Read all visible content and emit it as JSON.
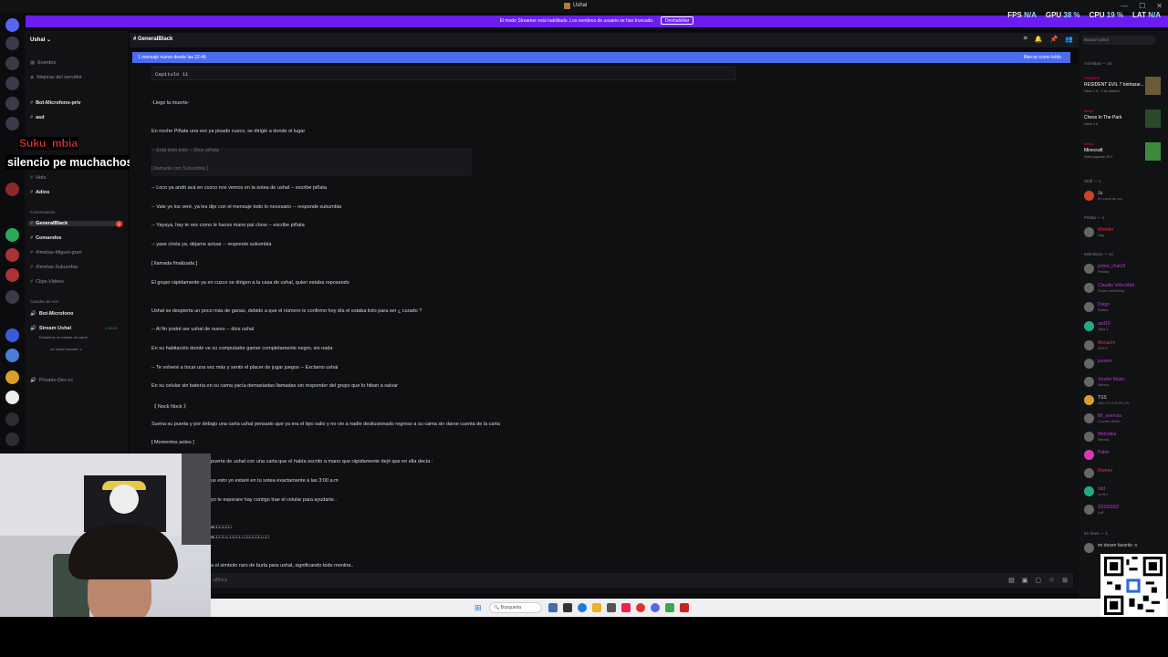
{
  "window": {
    "title": "Ushal"
  },
  "banner": {
    "text": "El modo Streamer está habilitado. Los nombres de usuario se han truncado.",
    "button": "Deshabilitar"
  },
  "overlay_stats": [
    {
      "label": "FPS",
      "value": "N/A"
    },
    {
      "label": "GPU",
      "value": "38 %"
    },
    {
      "label": "CPU",
      "value": "19 %"
    },
    {
      "label": "LAT",
      "value": "N/A"
    }
  ],
  "server": {
    "name": "Ushal ⌄"
  },
  "channels": {
    "events": "Eventos",
    "boosts": "Mejoras del servidor",
    "items": [
      {
        "name": "Bot-Microfono-priv",
        "bold": true
      },
      {
        "name": "asd",
        "bold": true
      },
      {
        "name": "Holo",
        "bold": false
      },
      {
        "name": "Adios",
        "bold": true
      },
      {
        "name": "GeneralBlack",
        "bold": true,
        "selected": true,
        "badge": "1"
      },
      {
        "name": "Comandos",
        "bold": true
      },
      {
        "name": "#Imetas-Miguel-gran",
        "bold": false
      },
      {
        "name": "#Imetas-Sukumbia",
        "bold": false
      },
      {
        "name": "Clips-Videos",
        "bold": false
      }
    ],
    "category_conv": "Conversación",
    "category_voice": "Canales de voz",
    "voice": [
      {
        "name": "Bot-Microfono"
      },
      {
        "name": "Stream Ushal",
        "time": "1:18:25"
      },
      {
        "name": "Privado Dev-cc"
      }
    ],
    "voice_sub": "Establece un estado de canal",
    "voice_user": "mi dosen favorito :v"
  },
  "overlay_chat": {
    "user": "Suku_mbia",
    "message": "silencio pe muchachos"
  },
  "chat": {
    "channel": "GeneralBlack",
    "new_messages": "1 mensaje nuevo desde las 22:46",
    "mark_read": "Marcar como leído",
    "code_header": "Capitulo 11",
    "lines": [
      {
        "text": "-Llego la muerte-",
        "dim": false
      },
      {
        "text": "En noche Piñata una vez ya pisado cuzco, se dirigió a donde el lugar",
        "dim": false
      },
      {
        "text": "-- Esta todo listo -- Dice piñata",
        "dim": true
      },
      {
        "text": "[ llamada con Sukumbia ]",
        "dim": true
      },
      {
        "text": "-- Loco ya andó acá en cuzco nos vemos en la sotea de ushal -- escribe piñata",
        "dim": false
      },
      {
        "text": "-- Vale yo los veré, ya les dije con el mensaje todo lo necesario -- responde sukumbia",
        "dim": false
      },
      {
        "text": "-- Yayaya, hay te vez como le haces mano pai chow -- escribe piñata",
        "dim": false
      },
      {
        "text": "-- yase chola ya, déjame actuar -- responde sukumbia",
        "dim": false
      },
      {
        "text": "[ llamada finalizada ]",
        "dim": false
      },
      {
        "text": "El grupo rápidamente ya en cuzco se dirigen a la casa de ushal, quien estaba reposando",
        "dim": false
      },
      {
        "text": "Ushal se despierta un poco más de ganas, debido a que el número le confirmo hoy día el estaba listo para ser ¿ curado ?",
        "dim": false
      },
      {
        "text": "-- Al fin podré ser ushal de nuevo -- dice ushal",
        "dim": false
      },
      {
        "text": "En su habitación donde ve su computador gamer completamente negro, sin nada",
        "dim": false
      },
      {
        "text": "-- Te volveré a tocar una vez más y sentir el placer de jugar juegos -- Exclamo ushal",
        "dim": false
      },
      {
        "text": "En su celular sin batería en su cama yacía demasiadas llamadas sin responder del grupo que lo hiban a salvar",
        "dim": false
      },
      {
        "text": "《 Nock Nock 》",
        "dim": false
      },
      {
        "text": "Suena su puerta y por debajo una carta ushal pensado que ya era el tipo salio y no vio a nadie desilusionado regreso a su cama sin darse cuenta de la carta",
        "dim": false
      },
      {
        "text": "[ Momentos antes ]",
        "dim": false
      }
    ],
    "bottom_lines": [
      "puerta de ushal con una carta que el había escrito a mano que rápidamente dejó que en ella decía :",
      "us esto yo estaré en tu sotea exactamente a las 3:00 a.m",
      "yo te esperare hay contigo trae el celular para ayudarte..",
      "a□□□□□□",
      "a□□□□.□□□□□.□□□□□□.□□",
      "a el simbolo raro de burla para ushal, significando todo mentira.."
    ],
    "input_placeholder": "alBlack"
  },
  "members": {
    "search_placeholder": "Buscar Ushal",
    "activity_header": "Actividad — 15",
    "activities": [
      {
        "user": "SOMBRA",
        "game": "RESIDENT EVIL 7 biohazar...",
        "meta": "Hace 1 d · 3 se unieron"
      },
      {
        "user": "Benja",
        "game": "Chess In The Park",
        "meta": "Hace 1 d"
      },
      {
        "user": "Benja",
        "game": "Minecraft",
        "meta": "Viste jugando 29 h"
      }
    ],
    "staff_header": "Staff — 1",
    "staff": [
      {
        "name": "Ju",
        "status": "En canal de voz"
      }
    ],
    "pinata_header": "Piñata — 1",
    "pinata": [
      {
        "name": "Wonder",
        "status": "Nap"
      }
    ],
    "miembros_header": "Miembros — 14",
    "miembros": [
      {
        "name": "primo_chat19",
        "status": "Partida"
      },
      {
        "name": "Claudio Velocidad",
        "status": "Robox web/Reloj"
      },
      {
        "name": "Diego",
        "status": "Roblox"
      },
      {
        "name": "asd19",
        "status": "Jada 2"
      },
      {
        "name": "Monachi",
        "status": "WOLF"
      },
      {
        "name": "jessem",
        "status": ""
      },
      {
        "name": "Jonder Music",
        "status": "Melody"
      },
      {
        "name": "TSS",
        "status": "ADICTO A ROBLOX"
      },
      {
        "name": "Mr_esencia",
        "status": "Counter-Strike"
      },
      {
        "name": "Melodina",
        "status": "Melody"
      },
      {
        "name": "Pablo",
        "status": ""
      },
      {
        "name": "Romeo",
        "status": ""
      },
      {
        "name": "xdd",
        "status": "no bro"
      },
      {
        "name": "ƧƧƧƧƧƧƧ",
        "status": "Luff"
      }
    ],
    "online_header": "En línea — 1",
    "online": [
      {
        "name": "mi dosen favorito :v",
        "status": ""
      }
    ]
  },
  "taskbar": {
    "search": "Búsqueda"
  }
}
